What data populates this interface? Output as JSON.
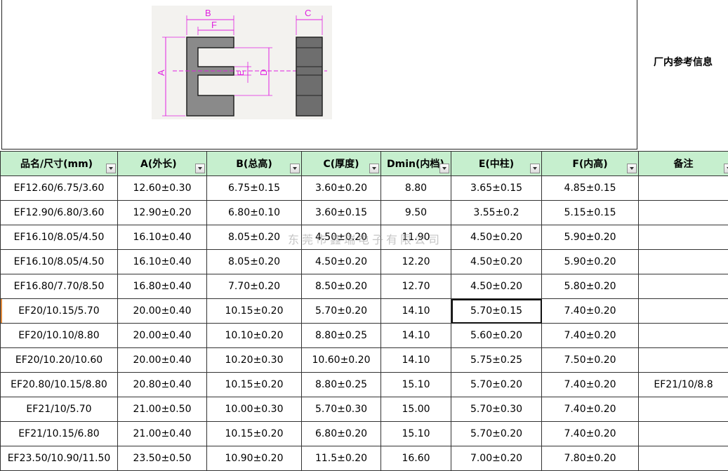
{
  "header_note": "厂内参考信息",
  "diagram": {
    "labels": {
      "a": "A",
      "b": "B",
      "c": "C",
      "d": "D",
      "e": "E",
      "f": "F"
    }
  },
  "columns": [
    {
      "key": "name",
      "label": "品名/尺寸(mm)"
    },
    {
      "key": "a",
      "label": "A(外长)"
    },
    {
      "key": "b",
      "label": "B(总高)"
    },
    {
      "key": "c",
      "label": "C(厚度)"
    },
    {
      "key": "d",
      "label": "Dmin(内档)"
    },
    {
      "key": "e",
      "label": "E(中柱)"
    },
    {
      "key": "f",
      "label": "F(内高)"
    },
    {
      "key": "note",
      "label": "备注"
    }
  ],
  "rows": [
    [
      "EF12.60/6.75/3.60",
      "12.60±0.30",
      "6.75±0.15",
      "3.60±0.20",
      "8.80",
      "3.65±0.15",
      "4.85±0.15",
      ""
    ],
    [
      "EF12.90/6.80/3.60",
      "12.90±0.20",
      "6.80±0.10",
      "3.60±0.15",
      "9.50",
      "3.55±0.2",
      "5.15±0.15",
      ""
    ],
    [
      "EF16.10/8.05/4.50",
      "16.10±0.40",
      "8.05±0.20",
      "4.50±0.20",
      "11.90",
      "4.50±0.20",
      "5.90±0.20",
      ""
    ],
    [
      "EF16.10/8.05/4.50",
      "16.10±0.40",
      "8.05±0.20",
      "4.50±0.20",
      "12.20",
      "4.50±0.20",
      "5.90±0.20",
      ""
    ],
    [
      "EF16.80/7.70/8.50",
      "16.80±0.40",
      "7.70±0.20",
      "8.50±0.20",
      "12.70",
      "4.50±0.20",
      "5.80±0.20",
      ""
    ],
    [
      "EF20/10.15/5.70",
      "20.00±0.40",
      "10.15±0.20",
      "5.70±0.20",
      "14.10",
      "5.70±0.15",
      "7.40±0.20",
      ""
    ],
    [
      "EF20/10.10/8.80",
      "20.00±0.40",
      "10.10±0.20",
      "8.80±0.25",
      "14.10",
      "5.60±0.20",
      "7.40±0.20",
      ""
    ],
    [
      "EF20/10.20/10.60",
      "20.00±0.40",
      "10.20±0.30",
      "10.60±0.20",
      "14.10",
      "5.75±0.25",
      "7.50±0.20",
      ""
    ],
    [
      "EF20.80/10.15/8.80",
      "20.80±0.40",
      "10.15±0.20",
      "8.80±0.25",
      "15.10",
      "5.70±0.20",
      "7.40±0.20",
      "EF21/10/8.8"
    ],
    [
      "EF21/10/5.70",
      "21.00±0.50",
      "10.00±0.30",
      "5.70±0.30",
      "15.00",
      "5.70±0.30",
      "7.40±0.20",
      ""
    ],
    [
      "EF21/10.15/6.80",
      "21.00±0.40",
      "10.15±0.20",
      "6.80±0.20",
      "15.10",
      "5.70±0.20",
      "7.40±0.20",
      ""
    ],
    [
      "EF23.50/10.90/11.50",
      "23.50±0.50",
      "10.90±0.20",
      "11.5±0.20",
      "16.60",
      "7.00±0.20",
      "7.80±0.20",
      ""
    ]
  ],
  "watermark": "东莞市鑫瑞电子有限公司"
}
